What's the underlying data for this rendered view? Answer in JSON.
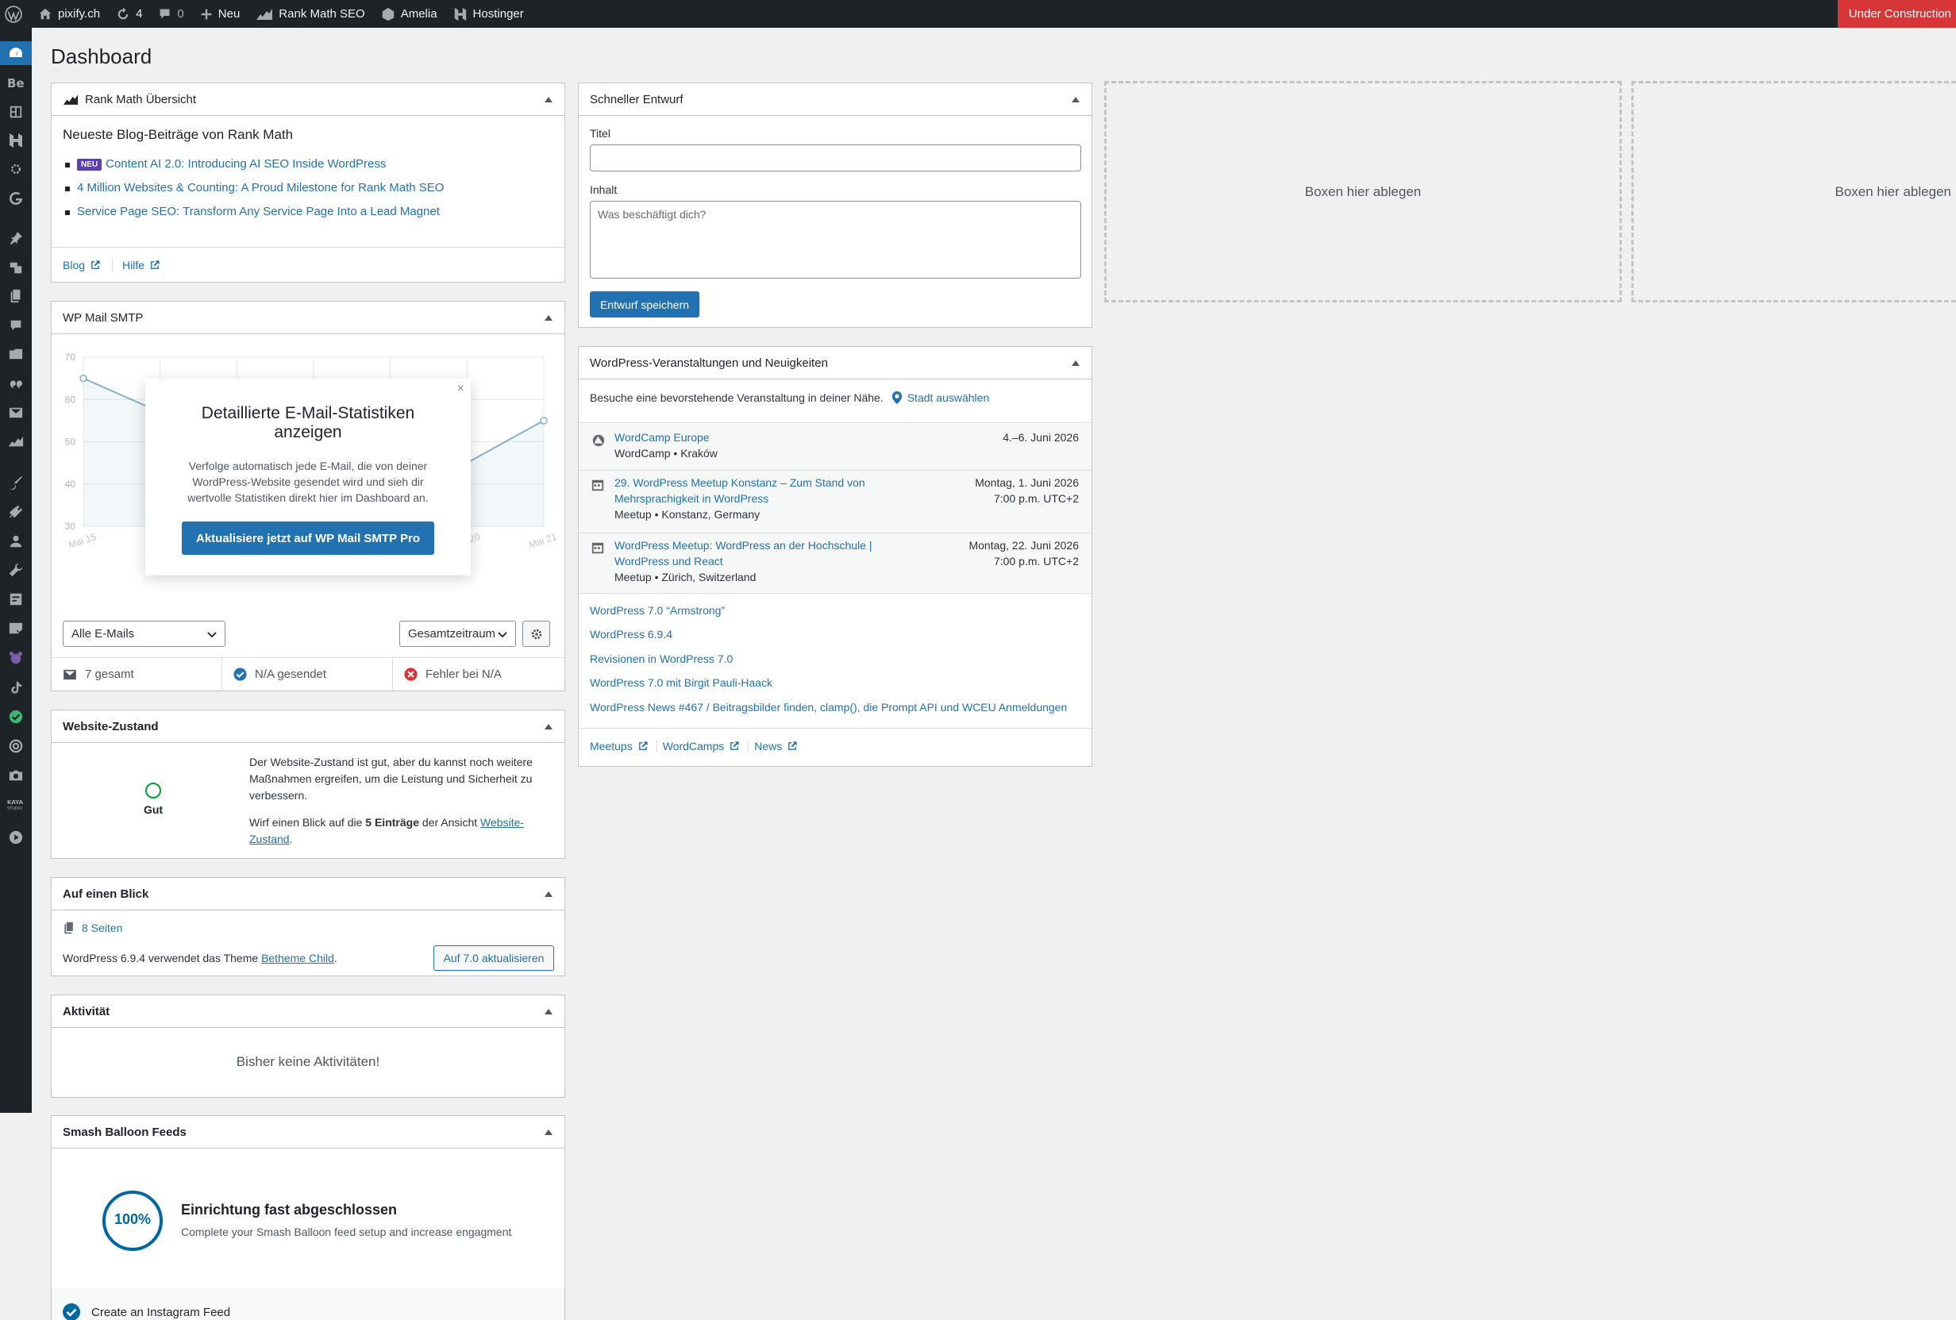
{
  "adminbar": {
    "site_name": "pixify.ch",
    "updates_count": "4",
    "comments_count": "0",
    "new_label": "Neu",
    "rankmath_label": "Rank Math SEO",
    "amelia_label": "Amelia",
    "hostinger_label": "Hostinger",
    "under_construction": "Under Construction"
  },
  "page_title": "Dashboard",
  "rankmath": {
    "title": "Rank Math Übersicht",
    "heading": "Neueste Blog-Beiträge von Rank Math",
    "new_badge": "NEU",
    "posts": [
      "Content AI 2.0: Introducing AI SEO Inside WordPress",
      "4 Million Websites & Counting: A Proud Milestone for Rank Math SEO",
      "Service Page SEO: Transform Any Service Page Into a Lead Magnet"
    ],
    "blog_link": "Blog",
    "help_link": "Hilfe"
  },
  "smtp": {
    "title": "WP Mail SMTP",
    "popup_title": "Detaillierte E-Mail-Statistiken anzeigen",
    "popup_text": "Verfolge automatisch jede E-Mail, die von deiner WordPress-Website gesendet wird und sieh dir wertvolle Statistiken direkt hier im Dashboard an.",
    "popup_button": "Aktualisiere jetzt auf WP Mail SMTP Pro",
    "filter_emails": "Alle E-Mails",
    "filter_period": "Gesamtzeitraum",
    "stat_total": "7 gesamt",
    "stat_sent": "N/A gesendet",
    "stat_failed": "Fehler bei N/A"
  },
  "chart_data": {
    "type": "line",
    "categories": [
      "Mai 15",
      "Mai 16",
      "Mai 17",
      "Mai 18",
      "Mai 19",
      "Mai 20",
      "Mai 21"
    ],
    "series": [
      {
        "values": [
          65,
          57,
          52,
          48,
          44,
          45,
          55
        ]
      }
    ],
    "ylim": [
      30,
      70
    ],
    "yticks": [
      "70",
      "60",
      "50",
      "40",
      "30"
    ],
    "grid": true,
    "color": "#2271b1"
  },
  "health": {
    "title": "Website-Zustand",
    "status": "Gut",
    "text1": "Der Website-Zustand ist gut, aber du kannst noch weitere Maßnahmen ergreifen, um die Leistung und Sicherheit zu verbessern.",
    "text2_prefix": "Wirf einen Blick auf die",
    "text2_bold": "5 Einträge",
    "text2_middle": "der Ansicht",
    "text2_link": "Website-Zustand",
    "text2_suffix": "."
  },
  "glance": {
    "title": "Auf einen Blick",
    "pages": "8 Seiten",
    "version_prefix": "WordPress 6.9.4 verwendet das Theme",
    "theme_link": "Betheme Child",
    "version_suffix": ".",
    "update_button": "Auf 7.0 aktualisieren"
  },
  "activity": {
    "title": "Aktivität",
    "empty": "Bisher keine Aktivitäten!"
  },
  "smash": {
    "title": "Smash Balloon Feeds",
    "progress": "100%",
    "progress_value": 1.0,
    "heading": "Einrichtung fast abgeschlossen",
    "subtext": "Complete your Smash Balloon feed setup and increase engagment",
    "task": "Create an Instagram Feed"
  },
  "draft": {
    "title": "Schneller Entwurf",
    "title_label": "Titel",
    "content_label": "Inhalt",
    "content_placeholder": "Was beschäftigt dich?",
    "save_button": "Entwurf speichern"
  },
  "events": {
    "title": "WordPress-Veranstaltungen und Neuigkeiten",
    "intro": "Besuche eine bevorstehende Veranstaltung in deiner Nähe.",
    "city_link": "Stadt auswählen",
    "items": [
      {
        "name": "WordCamp Europe",
        "name2": "",
        "meta": "WordCamp • Kraków",
        "date": "4.–6. Juni 2026",
        "time": ""
      },
      {
        "name": "29. WordPress Meetup Konstanz – Zum Stand von",
        "name2": "Mehrsprachigkeit in WordPress",
        "meta": "Meetup • Konstanz, Germany",
        "date": "Montag, 1. Juni 2026",
        "time": "7:00 p.m. UTC+2"
      },
      {
        "name": "WordPress Meetup: WordPress an der Hochschule |",
        "name2": "WordPress und React",
        "meta": "Meetup • Zürich, Switzerland",
        "date": "Montag, 22. Juni 2026",
        "time": "7:00 p.m. UTC+2"
      }
    ],
    "news": [
      "WordPress 7.0 “Armstrong”",
      "WordPress 6.9.4",
      "Revisionen in WordPress 7.0",
      "WordPress 7.0 mit Birgit Pauli-Haack",
      "WordPress News #467 / Beitragsbilder finden, clamp(), die Prompt API und WCEU Anmeldungen"
    ],
    "footer": [
      "Meetups",
      "WordCamps",
      "News"
    ]
  },
  "dropzones": [
    "Boxen hier ablegen",
    "Boxen hier ablegen"
  ]
}
